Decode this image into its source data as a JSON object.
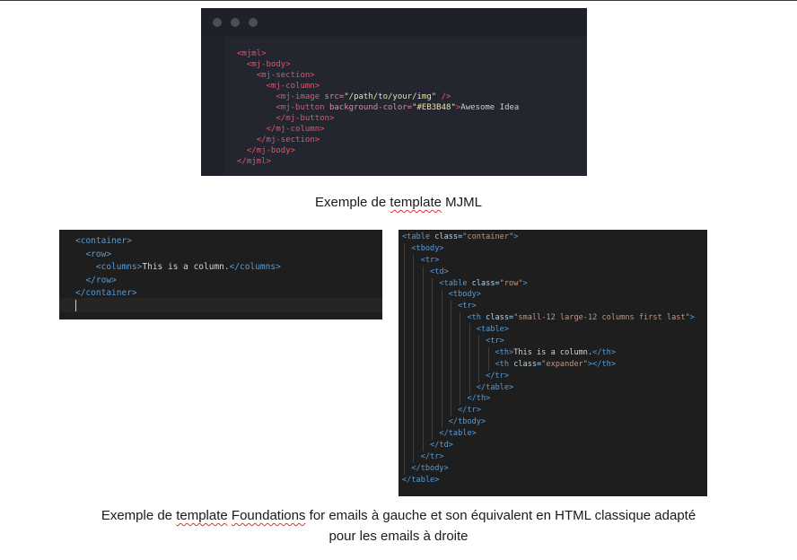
{
  "mjml_example": {
    "lines": [
      {
        "indent": "",
        "parts": [
          {
            "t": "<mjml>",
            "c": "t-red"
          }
        ]
      },
      {
        "indent": "  ",
        "parts": [
          {
            "t": "<mj-body>",
            "c": "t-red"
          }
        ]
      },
      {
        "indent": "    ",
        "parts": [
          {
            "t": "<mj-section>",
            "c": "t-red"
          }
        ]
      },
      {
        "indent": "      ",
        "parts": [
          {
            "t": "<mj-column>",
            "c": "t-red"
          }
        ]
      },
      {
        "indent": "        ",
        "parts": [
          {
            "t": "<mj-image ",
            "c": "t-red"
          },
          {
            "t": "src=",
            "c": "t-attr"
          },
          {
            "t": "\"/path/to/your/img\"",
            "c": "t-str"
          },
          {
            "t": " />",
            "c": "t-red"
          }
        ]
      },
      {
        "indent": "        ",
        "parts": [
          {
            "t": "<mj-button ",
            "c": "t-red"
          },
          {
            "t": "background-color=",
            "c": "t-attr"
          },
          {
            "t": "\"#EB3B48\"",
            "c": "t-str"
          },
          {
            "t": ">",
            "c": "t-red"
          },
          {
            "t": "Awesome Idea",
            "c": "t-plain"
          }
        ]
      },
      {
        "indent": "        ",
        "parts": [
          {
            "t": "</mj-button>",
            "c": "t-red"
          }
        ]
      },
      {
        "indent": "      ",
        "parts": [
          {
            "t": "</mj-column>",
            "c": "t-red"
          }
        ]
      },
      {
        "indent": "    ",
        "parts": [
          {
            "t": "</mj-section>",
            "c": "t-red"
          }
        ]
      },
      {
        "indent": "  ",
        "parts": [
          {
            "t": "</mj-body>",
            "c": "t-red"
          }
        ]
      },
      {
        "indent": "",
        "parts": [
          {
            "t": "</mjml>",
            "c": "t-red"
          }
        ]
      }
    ]
  },
  "caption_mjml": {
    "before": "Exemple de ",
    "wavy": "template",
    "after": " MJML"
  },
  "foundation_example": {
    "lines": [
      {
        "indent": "",
        "parts": [
          {
            "t": "<container>",
            "c": "k-tag"
          }
        ]
      },
      {
        "indent": "  ",
        "parts": [
          {
            "t": "<row>",
            "c": "k-tag"
          }
        ]
      },
      {
        "indent": "    ",
        "parts": [
          {
            "t": "<columns>",
            "c": "k-tag"
          },
          {
            "t": "This is a column.",
            "c": "k-txt"
          },
          {
            "t": "</columns>",
            "c": "k-tag"
          }
        ]
      },
      {
        "indent": "  ",
        "parts": [
          {
            "t": "</row>",
            "c": "k-tag"
          }
        ]
      },
      {
        "indent": "",
        "parts": [
          {
            "t": "</container>",
            "c": "k-tag"
          }
        ]
      }
    ]
  },
  "html_example": {
    "lines": [
      {
        "indent": "",
        "parts": [
          {
            "t": "<table ",
            "c": "k-tag"
          },
          {
            "t": "class=",
            "c": "k-attr"
          },
          {
            "t": "\"container\"",
            "c": "k-str"
          },
          {
            "t": ">",
            "c": "k-tag"
          }
        ]
      },
      {
        "indent": "  ",
        "parts": [
          {
            "t": "<tbody>",
            "c": "k-tag"
          }
        ]
      },
      {
        "indent": "    ",
        "parts": [
          {
            "t": "<tr>",
            "c": "k-tag"
          }
        ]
      },
      {
        "indent": "      ",
        "parts": [
          {
            "t": "<td>",
            "c": "k-tag"
          }
        ]
      },
      {
        "indent": "        ",
        "parts": [
          {
            "t": "<table ",
            "c": "k-tag"
          },
          {
            "t": "class=",
            "c": "k-attr"
          },
          {
            "t": "\"row\"",
            "c": "k-str"
          },
          {
            "t": ">",
            "c": "k-tag"
          }
        ]
      },
      {
        "indent": "          ",
        "parts": [
          {
            "t": "<tbody>",
            "c": "k-tag"
          }
        ]
      },
      {
        "indent": "            ",
        "parts": [
          {
            "t": "<tr>",
            "c": "k-tag"
          }
        ]
      },
      {
        "indent": "              ",
        "parts": [
          {
            "t": "<th ",
            "c": "k-tag"
          },
          {
            "t": "class=",
            "c": "k-attr"
          },
          {
            "t": "\"small-12 large-12 columns first last\"",
            "c": "k-str"
          },
          {
            "t": ">",
            "c": "k-tag"
          }
        ]
      },
      {
        "indent": "                ",
        "parts": [
          {
            "t": "<table>",
            "c": "k-tag"
          }
        ]
      },
      {
        "indent": "                  ",
        "parts": [
          {
            "t": "<tr>",
            "c": "k-tag"
          }
        ]
      },
      {
        "indent": "                    ",
        "parts": [
          {
            "t": "<th>",
            "c": "k-tag"
          },
          {
            "t": "This is a column.",
            "c": "k-txt"
          },
          {
            "t": "</th>",
            "c": "k-tag"
          }
        ]
      },
      {
        "indent": "                    ",
        "parts": [
          {
            "t": "<th ",
            "c": "k-tag"
          },
          {
            "t": "class=",
            "c": "k-attr"
          },
          {
            "t": "\"expander\"",
            "c": "k-str"
          },
          {
            "t": "></th>",
            "c": "k-tag"
          }
        ]
      },
      {
        "indent": "                  ",
        "parts": [
          {
            "t": "</tr>",
            "c": "k-tag"
          }
        ]
      },
      {
        "indent": "                ",
        "parts": [
          {
            "t": "</table>",
            "c": "k-tag"
          }
        ]
      },
      {
        "indent": "              ",
        "parts": [
          {
            "t": "</th>",
            "c": "k-tag"
          }
        ]
      },
      {
        "indent": "            ",
        "parts": [
          {
            "t": "</tr>",
            "c": "k-tag"
          }
        ]
      },
      {
        "indent": "          ",
        "parts": [
          {
            "t": "</tbody>",
            "c": "k-tag"
          }
        ]
      },
      {
        "indent": "        ",
        "parts": [
          {
            "t": "</table>",
            "c": "k-tag"
          }
        ]
      },
      {
        "indent": "      ",
        "parts": [
          {
            "t": "</td>",
            "c": "k-tag"
          }
        ]
      },
      {
        "indent": "    ",
        "parts": [
          {
            "t": "</tr>",
            "c": "k-tag"
          }
        ]
      },
      {
        "indent": "  ",
        "parts": [
          {
            "t": "</tbody>",
            "c": "k-tag"
          }
        ]
      },
      {
        "indent": "",
        "parts": [
          {
            "t": "</table>",
            "c": "k-tag"
          }
        ]
      }
    ]
  },
  "caption_foundation": {
    "p1": "Exemple de ",
    "w1": "template",
    "p2": " ",
    "w2": "Foundations",
    "p3": " for emails à gauche et son équivalent en HTML classique adapté",
    "line2": "pour les emails à droite"
  }
}
